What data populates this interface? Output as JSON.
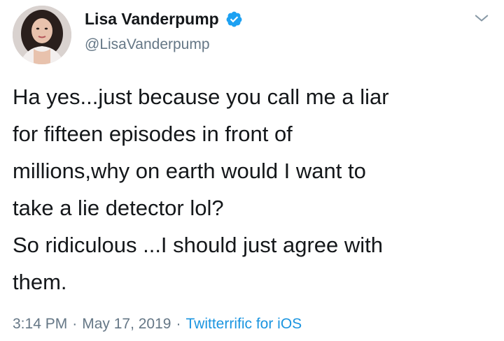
{
  "user": {
    "display_name": "Lisa Vanderpump",
    "handle": "@LisaVanderpump",
    "verified": true
  },
  "tweet": {
    "lines": [
      "Ha yes...just because you call me a liar",
      "for fifteen episodes in front of",
      "millions,why on earth would I want to",
      "take a lie detector lol?",
      "So ridiculous ...I should just agree with",
      "them."
    ],
    "time": "3:14 PM",
    "date": "May 17, 2019",
    "separator": "·",
    "source": "Twitterrific for iOS"
  },
  "icons": {
    "verified": "verified-badge-icon",
    "menu": "chevron-down-icon"
  },
  "colors": {
    "text": "#14171a",
    "secondary": "#657786",
    "link": "#1b95e0",
    "verified": "#1da1f2"
  }
}
